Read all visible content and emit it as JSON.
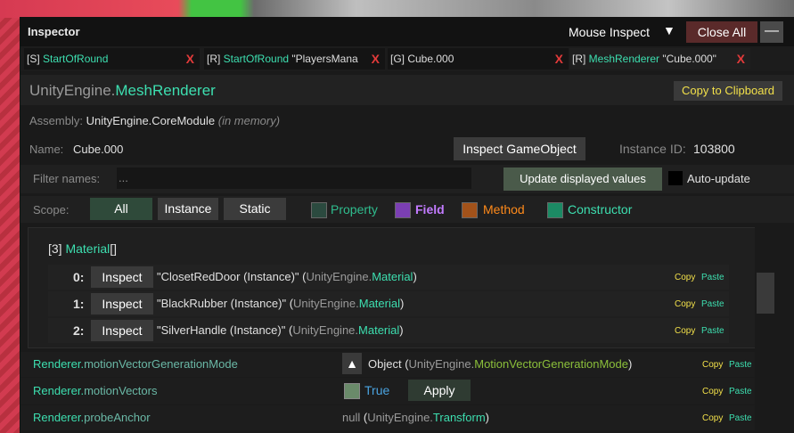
{
  "window": {
    "title": "Inspector",
    "mouse_inspect": "Mouse Inspect",
    "arrow": "▼",
    "close_all": "Close All",
    "minimize": "—"
  },
  "tabs": [
    {
      "prefix": "[S] ",
      "name": "StartOfRound",
      "suffix": ""
    },
    {
      "prefix": "[R] ",
      "name": "StartOfRound",
      "suffix": " \"PlayersMana"
    },
    {
      "prefix": "[G] ",
      "name": "",
      "suffix": "Cube.000"
    },
    {
      "prefix": "[R] ",
      "name": "MeshRenderer",
      "suffix": " \"Cube.000\""
    }
  ],
  "tab_close": "X",
  "header": {
    "ns": "UnityEngine.",
    "type": "MeshRenderer",
    "copy": "Copy to Clipboard"
  },
  "assembly": {
    "label": "Assembly: ",
    "value": "UnityEngine.CoreModule",
    "note": "(in memory)"
  },
  "name_row": {
    "label": "Name:",
    "value": "Cube.000",
    "inspect_go": "Inspect GameObject",
    "instance_label": "Instance ID:",
    "instance_id": "103800"
  },
  "filter": {
    "label": "Filter names:",
    "placeholder": "...",
    "update": "Update displayed values",
    "auto": "Auto-update"
  },
  "scope": {
    "label": "Scope:",
    "all": "All",
    "instance": "Instance",
    "static": "Static"
  },
  "member_types": [
    {
      "label": "Property",
      "color": "#3ddfb0"
    },
    {
      "label": "Field",
      "color": "#c27bff"
    },
    {
      "label": "Method",
      "color": "#ff8a1a"
    },
    {
      "label": "Constructor",
      "color": "#3ddfb0"
    }
  ],
  "list": {
    "count": "[3] ",
    "type": "Material",
    "suffix": "[]"
  },
  "entries": [
    {
      "index": "0:",
      "inspect": "Inspect",
      "value": "\"ClosetRedDoor (Instance)\"",
      "ns": "UnityEngine.",
      "t": "Material"
    },
    {
      "index": "1:",
      "inspect": "Inspect",
      "value": "\"BlackRubber (Instance)\"",
      "ns": "UnityEngine.",
      "t": "Material"
    },
    {
      "index": "2:",
      "inspect": "Inspect",
      "value": "\"SilverHandle (Instance)\"",
      "ns": "UnityEngine.",
      "t": "Material"
    }
  ],
  "copy": "Copy",
  "paste": "Paste",
  "members": [
    {
      "owner": "Renderer.",
      "name": "motionVectorGenerationMode"
    },
    {
      "owner": "Renderer.",
      "name": "motionVectors"
    },
    {
      "owner": "Renderer.",
      "name": "probeAnchor"
    }
  ],
  "member_values": {
    "mv_mode_arrow": "▲",
    "mv_mode_obj": "Object",
    "mv_mode_ns": "UnityEngine.",
    "mv_mode_type": "MotionVectorGenerationMode",
    "mv_true": "True",
    "apply": "Apply",
    "probe_null": "null",
    "probe_ns": "UnityEngine.",
    "probe_type": "Transform"
  }
}
